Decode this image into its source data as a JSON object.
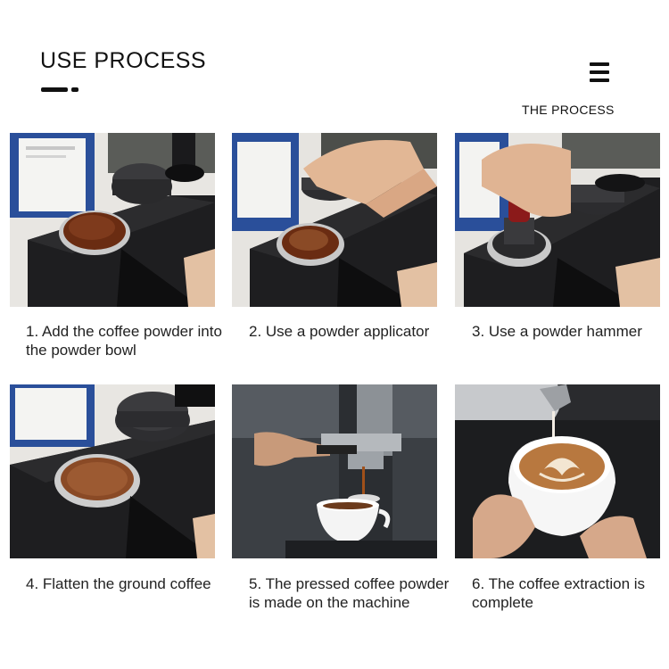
{
  "header": {
    "title": "USE PROCESS",
    "subtitle": "THE PROCESS"
  },
  "steps": [
    {
      "caption": "1. Add the coffee powder into the powder bowl"
    },
    {
      "caption": "2. Use a powder applicator"
    },
    {
      "caption": "3. Use a powder hammer"
    },
    {
      "caption": "4. Flatten the ground coffee"
    },
    {
      "caption": "5. The pressed coffee powder is made on the machine"
    },
    {
      "caption": "6. The coffee extraction is complete"
    }
  ],
  "icons": [
    "menu-icon"
  ],
  "colors": {
    "text": "#1a1a1a",
    "base": "#1c1c1e",
    "coffee": "#7a3d1f",
    "crema": "#c68a4e"
  }
}
